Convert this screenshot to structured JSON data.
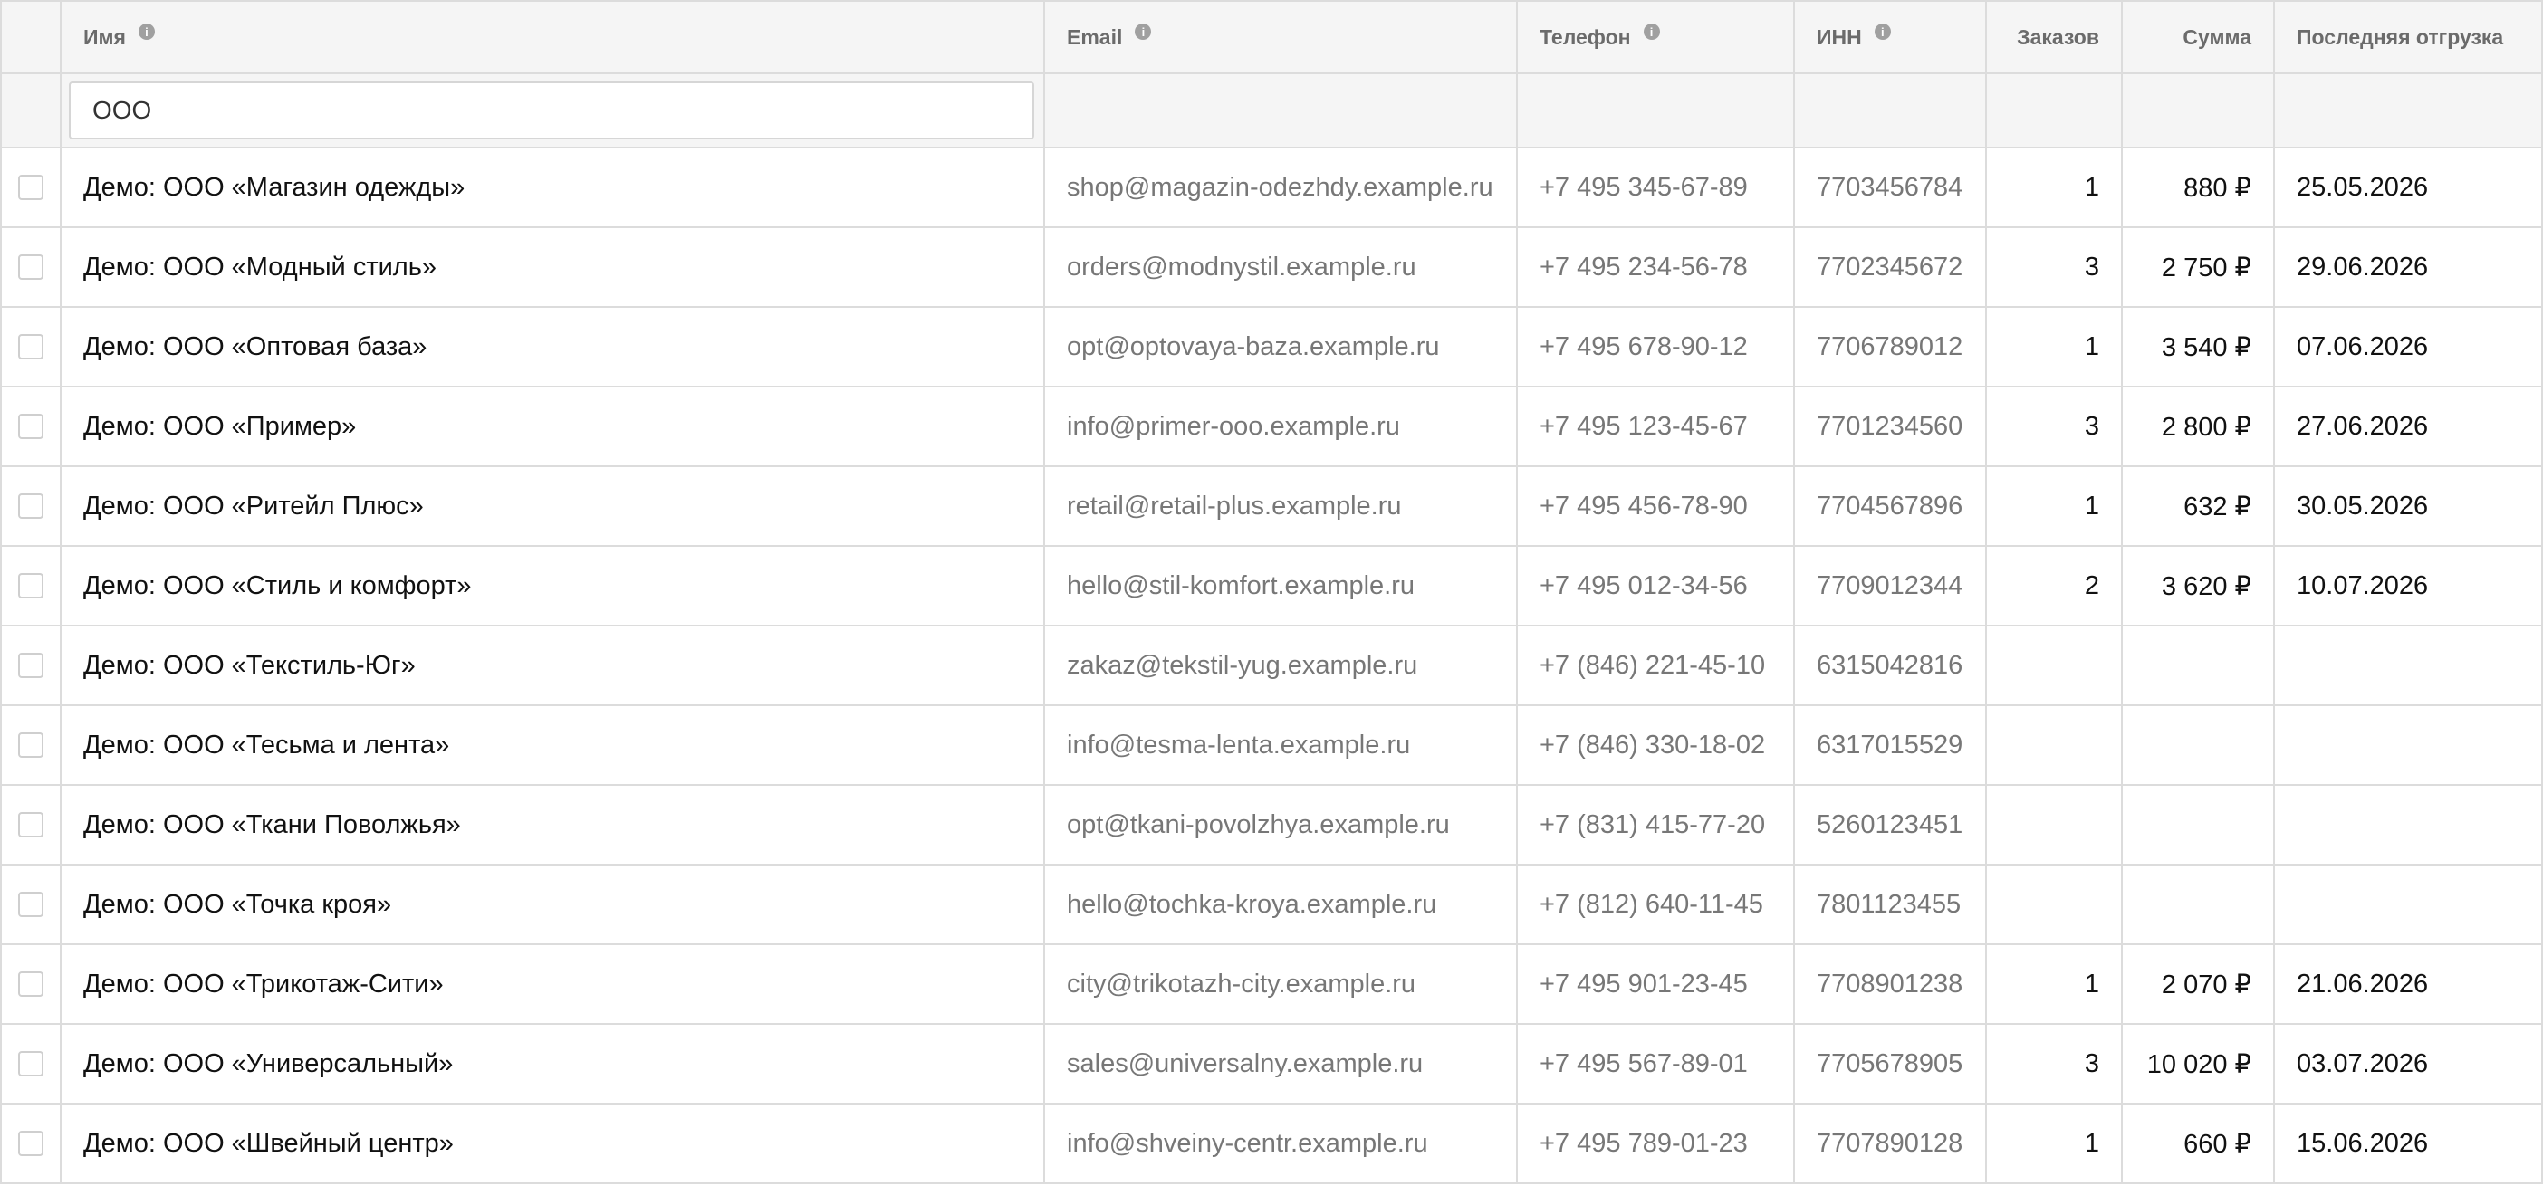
{
  "columns": {
    "name": "Имя",
    "email": "Email",
    "phone": "Телефон",
    "inn": "ИНН",
    "orders": "Заказов",
    "sum": "Сумма",
    "last_shipment": "Последняя отгрузка"
  },
  "filter": {
    "name_value": "ООО"
  },
  "rows": [
    {
      "name": "Демо: ООО «Магазин одежды»",
      "email": "shop@magazin-odezhdy.example.ru",
      "phone": "+7 495 345-67-89",
      "inn": "7703456784",
      "orders": "1",
      "sum": "880 ₽",
      "last": "25.05.2026"
    },
    {
      "name": "Демо: ООО «Модный стиль»",
      "email": "orders@modnystil.example.ru",
      "phone": "+7 495 234-56-78",
      "inn": "7702345672",
      "orders": "3",
      "sum": "2 750 ₽",
      "last": "29.06.2026"
    },
    {
      "name": "Демо: ООО «Оптовая база»",
      "email": "opt@optovaya-baza.example.ru",
      "phone": "+7 495 678-90-12",
      "inn": "7706789012",
      "orders": "1",
      "sum": "3 540 ₽",
      "last": "07.06.2026"
    },
    {
      "name": "Демо: ООО «Пример»",
      "email": "info@primer-ooo.example.ru",
      "phone": "+7 495 123-45-67",
      "inn": "7701234560",
      "orders": "3",
      "sum": "2 800 ₽",
      "last": "27.06.2026"
    },
    {
      "name": "Демо: ООО «Ритейл Плюс»",
      "email": "retail@retail-plus.example.ru",
      "phone": "+7 495 456-78-90",
      "inn": "7704567896",
      "orders": "1",
      "sum": "632 ₽",
      "last": "30.05.2026"
    },
    {
      "name": "Демо: ООО «Стиль и комфорт»",
      "email": "hello@stil-komfort.example.ru",
      "phone": "+7 495 012-34-56",
      "inn": "7709012344",
      "orders": "2",
      "sum": "3 620 ₽",
      "last": "10.07.2026"
    },
    {
      "name": "Демо: ООО «Текстиль-Юг»",
      "email": "zakaz@tekstil-yug.example.ru",
      "phone": "+7 (846) 221-45-10",
      "inn": "6315042816",
      "orders": "",
      "sum": "",
      "last": ""
    },
    {
      "name": "Демо: ООО «Тесьма и лента»",
      "email": "info@tesma-lenta.example.ru",
      "phone": "+7 (846) 330-18-02",
      "inn": "6317015529",
      "orders": "",
      "sum": "",
      "last": ""
    },
    {
      "name": "Демо: ООО «Ткани Поволжья»",
      "email": "opt@tkani-povolzhya.example.ru",
      "phone": "+7 (831) 415-77-20",
      "inn": "5260123451",
      "orders": "",
      "sum": "",
      "last": ""
    },
    {
      "name": "Демо: ООО «Точка кроя»",
      "email": "hello@tochka-kroya.example.ru",
      "phone": "+7 (812) 640-11-45",
      "inn": "7801123455",
      "orders": "",
      "sum": "",
      "last": ""
    },
    {
      "name": "Демо: ООО «Трикотаж-Сити»",
      "email": "city@trikotazh-city.example.ru",
      "phone": "+7 495 901-23-45",
      "inn": "7708901238",
      "orders": "1",
      "sum": "2 070 ₽",
      "last": "21.06.2026"
    },
    {
      "name": "Демо: ООО «Универсальный»",
      "email": "sales@universalny.example.ru",
      "phone": "+7 495 567-89-01",
      "inn": "7705678905",
      "orders": "3",
      "sum": "10 020 ₽",
      "last": "03.07.2026"
    },
    {
      "name": "Демо: ООО «Швейный центр»",
      "email": "info@shveiny-centr.example.ru",
      "phone": "+7 495 789-01-23",
      "inn": "7707890128",
      "orders": "1",
      "sum": "660 ₽",
      "last": "15.06.2026"
    }
  ]
}
